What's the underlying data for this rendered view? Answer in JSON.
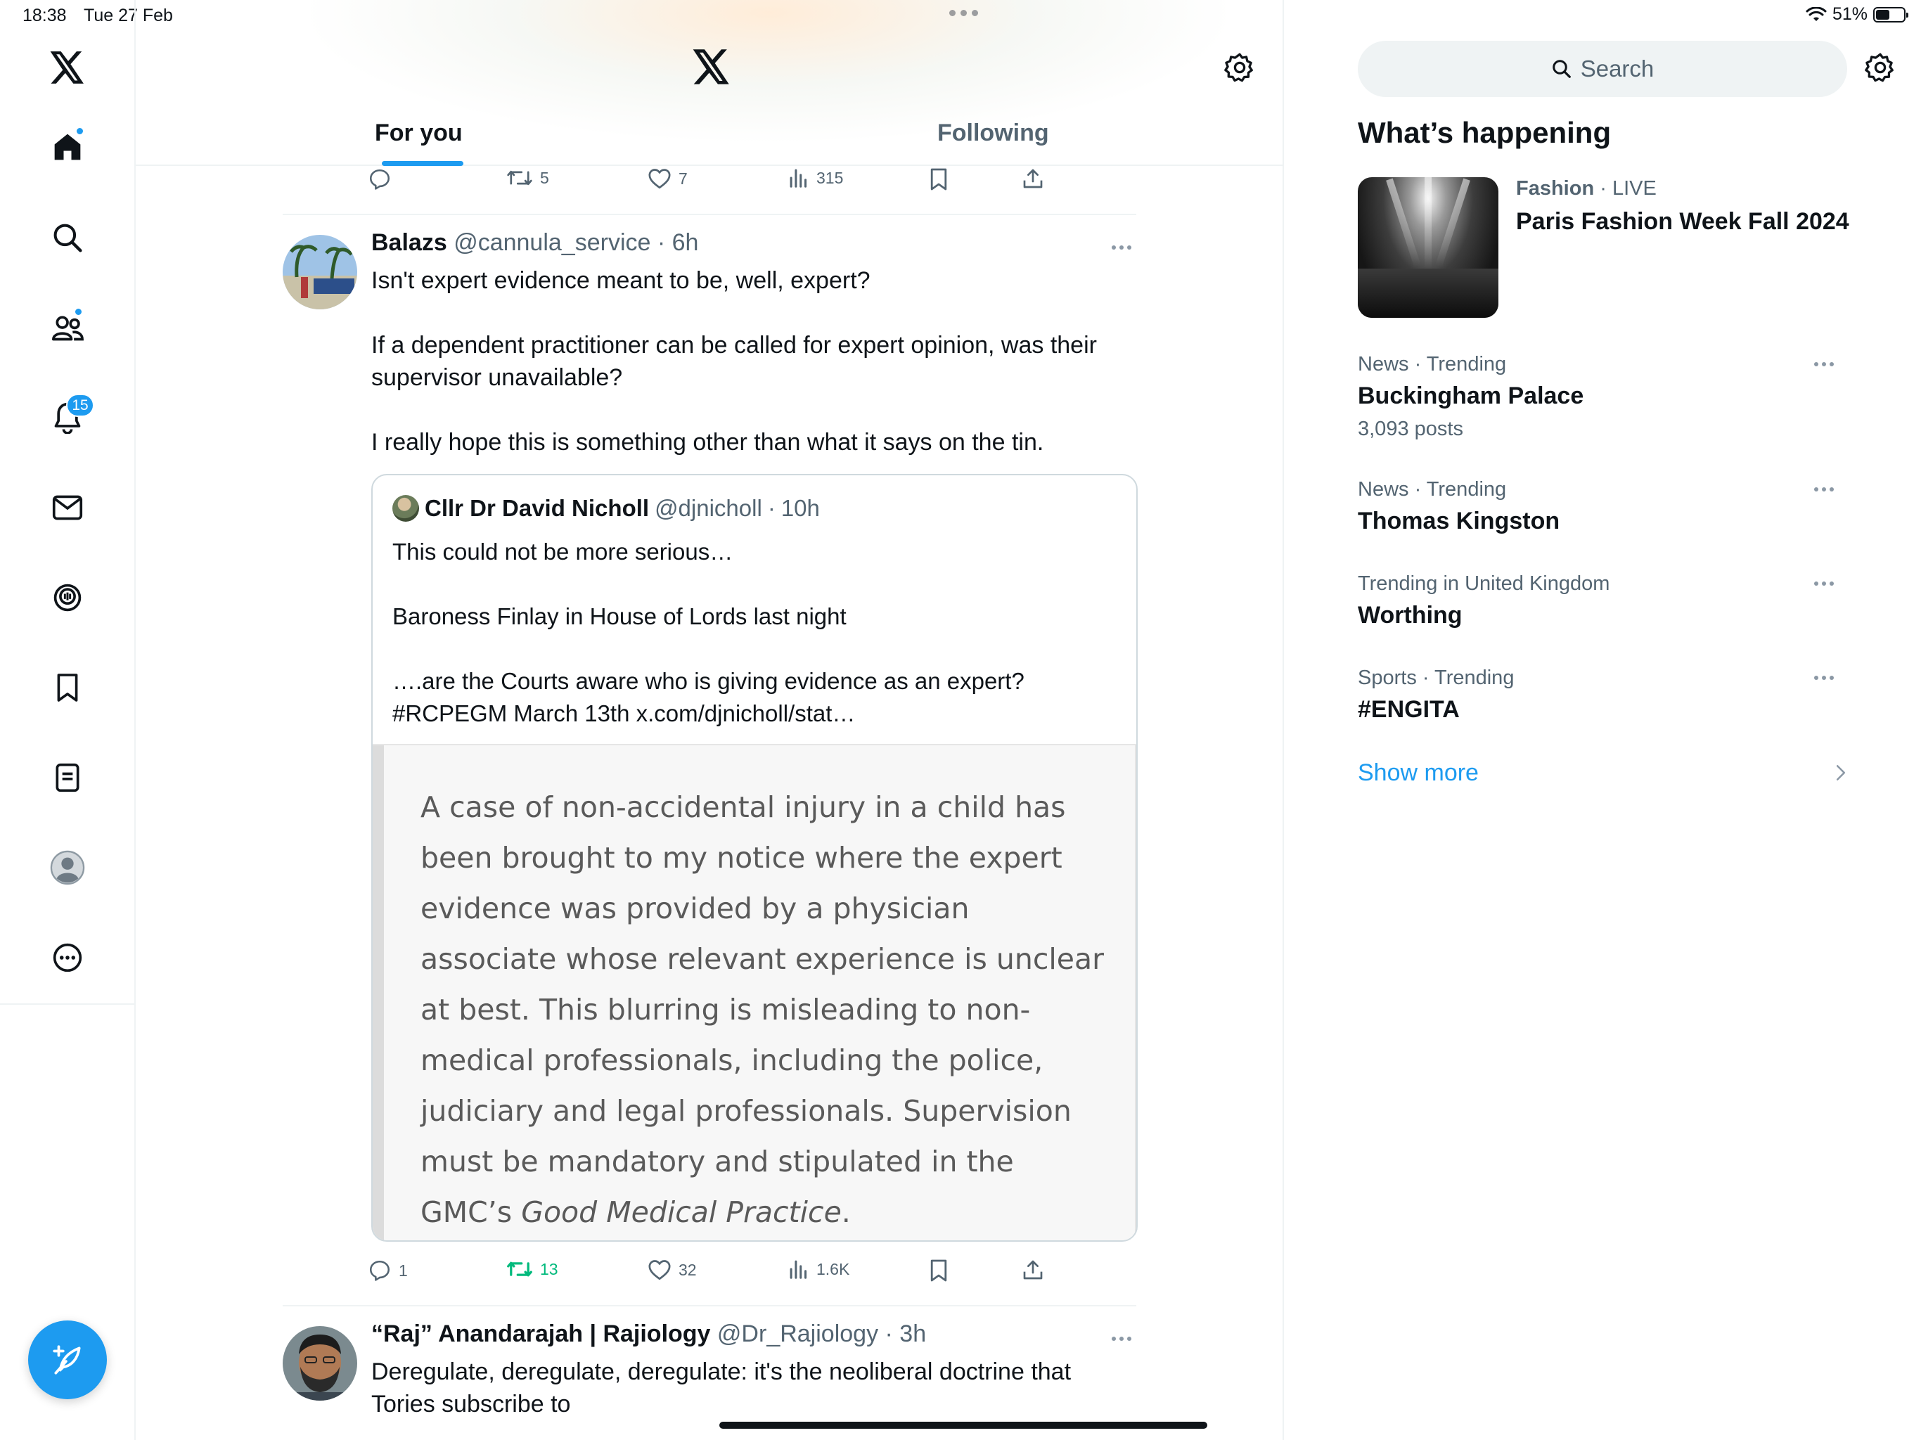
{
  "status_bar": {
    "time": "18:38",
    "date": "Tue 27 Feb",
    "battery": "51%",
    "battery_level": 0.51
  },
  "nav": {
    "notifications_count": "15",
    "items": [
      "x-logo",
      "home",
      "explore",
      "communities",
      "notifications",
      "messages",
      "spaces",
      "bookmarks",
      "lists",
      "profile",
      "more"
    ]
  },
  "header": {
    "tabs": [
      {
        "label": "For you",
        "selected": true
      },
      {
        "label": "Following",
        "selected": false
      }
    ]
  },
  "previous_tweet": {
    "retweets": "5",
    "likes": "7",
    "views": "315"
  },
  "tweet1": {
    "name": "Balazs",
    "handle": "@cannula_service",
    "time": "6h",
    "paragraphs": [
      "Isn't expert evidence meant to be, well, expert?",
      "If a dependent practitioner can be called for expert opinion, was their supervisor unavailable?",
      "I really hope this is something other than what it says on the tin."
    ],
    "quote": {
      "name": "Cllr Dr David Nicholl",
      "handle": "@djnicholl",
      "time": "10h",
      "paragraphs": [
        "This could not be more serious…",
        "Baroness Finlay in House of Lords last night",
        "….are the Courts aware who is giving evidence as an expert? #RCPEGM March 13th x.com/djnicholl/stat…"
      ],
      "excerpt": {
        "text": "A case of non-accidental injury in a child has been brought to my notice where the expert evidence was provided by a physician associate whose relevant experience is unclear at best. This blurring is misleading to non-medical professionals, including the police, judiciary and legal professionals. Supervision must be mandatory and stipulated in the GMC’s ",
        "italic": "Good Medical Practice",
        "end": "."
      }
    },
    "replies": "1",
    "retweets": "13",
    "likes": "32",
    "views": "1.6K"
  },
  "tweet2": {
    "name": "“Raj” Anandarajah | Rajiology",
    "handle": "@Dr_Rajiology",
    "time": "3h",
    "text": "Deregulate, deregulate, deregulate: it's the neoliberal doctrine that Tories subscribe to"
  },
  "sidebar": {
    "search_placeholder": "Search",
    "title": "What’s happening",
    "featured": {
      "category": "Fashion",
      "live": "LIVE",
      "title": "Paris Fashion Week Fall 2024"
    },
    "trends": [
      {
        "category": "News · Trending",
        "name": "Buckingham Palace",
        "posts": "3,093 posts"
      },
      {
        "category": "News · Trending",
        "name": "Thomas Kingston",
        "posts": ""
      },
      {
        "category": "Trending in United Kingdom",
        "name": "Worthing",
        "posts": ""
      },
      {
        "category": "Sports · Trending",
        "name": "#ENGITA",
        "posts": ""
      }
    ],
    "show_more": "Show more"
  },
  "colors": {
    "accent": "#1d9bf0",
    "retweet_active": "#00ba7c",
    "text": "#0f1419",
    "secondary": "#536471"
  }
}
